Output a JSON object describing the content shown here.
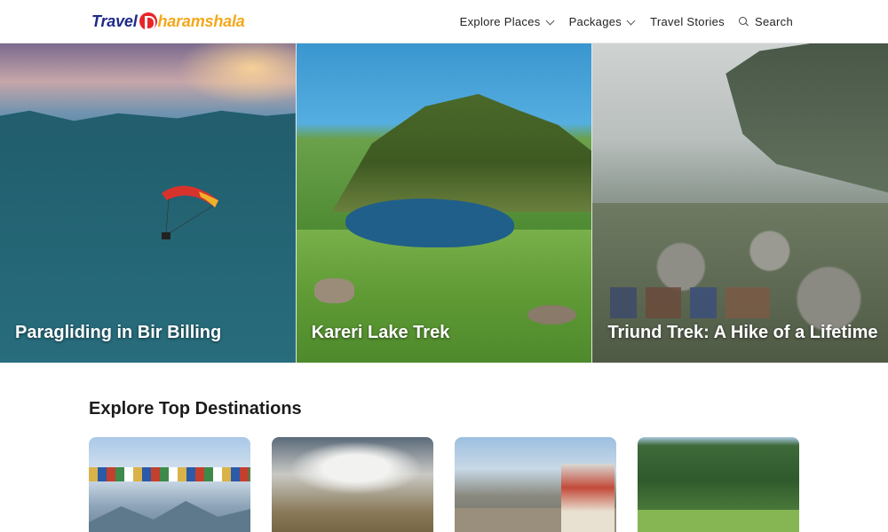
{
  "header": {
    "logo": {
      "part1": "Travel",
      "part2": "haramshala"
    },
    "nav": [
      {
        "label": "Explore Places",
        "has_dropdown": true
      },
      {
        "label": "Packages",
        "has_dropdown": true
      },
      {
        "label": "Travel Stories",
        "has_dropdown": false
      },
      {
        "label": "Search",
        "icon": "search-icon"
      }
    ]
  },
  "hero": [
    {
      "caption": "Paragliding in Bir Billing"
    },
    {
      "caption": "Kareri Lake Trek"
    },
    {
      "caption": "Triund Trek: A Hike of a Lifetime"
    }
  ],
  "destinations": {
    "title": "Explore Top Destinations"
  },
  "colors": {
    "logo_blue": "#1f2a87",
    "logo_red": "#e8252b",
    "logo_orange": "#f3a81b"
  }
}
